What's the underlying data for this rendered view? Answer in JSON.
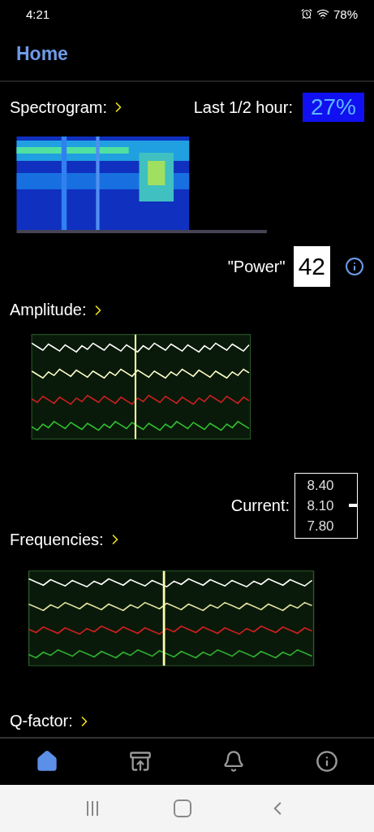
{
  "status_bar": {
    "time": "4:21",
    "battery": "78%"
  },
  "header": {
    "title": "Home"
  },
  "spectrogram": {
    "label": "Spectrogram:",
    "last_label": "Last 1/2 hour:",
    "last_value": "27%",
    "image": {
      "kind": "picture"
    }
  },
  "amplitude": {
    "label": "Amplitude:",
    "power_label": "\"Power\"",
    "power_value": "42",
    "image": {
      "kind": "picture"
    }
  },
  "frequencies": {
    "current_label": "Current:",
    "scale": [
      "8.40",
      "8.10",
      "7.80"
    ],
    "label": "Frequencies:",
    "image": {
      "kind": "picture"
    }
  },
  "q_factor": {
    "label": "Q-factor:"
  },
  "tabs": [
    {
      "kind": "home",
      "selected": true
    },
    {
      "kind": "archive",
      "selected": false
    },
    {
      "kind": "bell",
      "selected": false
    },
    {
      "kind": "info",
      "selected": false
    }
  ]
}
